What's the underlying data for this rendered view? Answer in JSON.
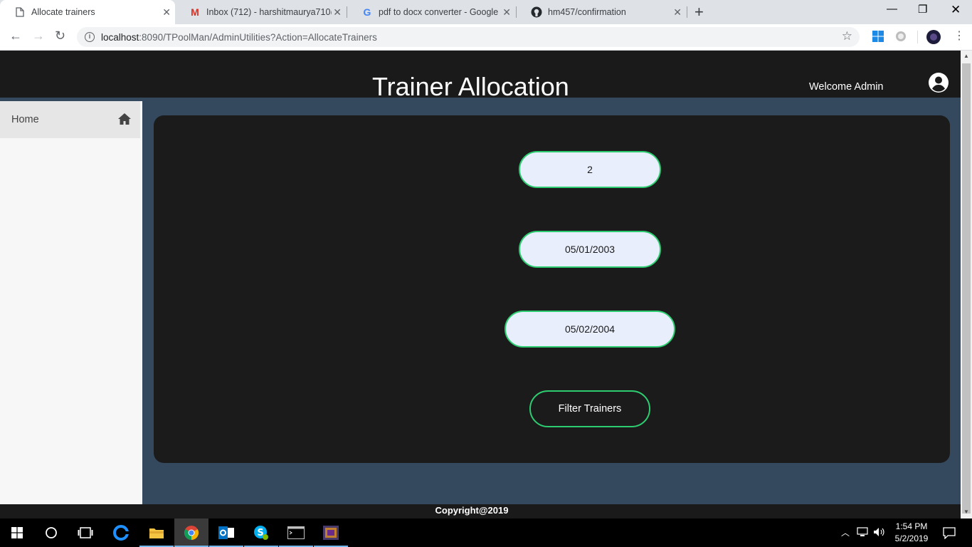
{
  "browser": {
    "tabs": [
      {
        "title": "Allocate trainers",
        "icon": "document-icon"
      },
      {
        "title": "Inbox (712) - harshitmaurya710@",
        "icon": "gmail-icon"
      },
      {
        "title": "pdf to docx converter - Google S",
        "icon": "google-icon"
      },
      {
        "title": "hm457/confirmation",
        "icon": "github-icon"
      }
    ],
    "url_host": "localhost",
    "url_rest": ":8090/TPoolMan/AdminUtilities?Action=AllocateTrainers"
  },
  "header": {
    "title": "Trainer Allocation",
    "welcome": "Welcome Admin",
    "user_icon": "user-circle-icon"
  },
  "sidebar": {
    "items": [
      {
        "label": "Home",
        "icon": "home-icon"
      }
    ]
  },
  "form": {
    "field1_value": "2",
    "field2_value": "05/01/2003",
    "field3_value": "05/02/2004",
    "submit_label": "Filter Trainers"
  },
  "footer": {
    "copyright": "Copyright@2019"
  },
  "taskbar": {
    "time": "1:54 PM",
    "date": "5/2/2019"
  },
  "colors": {
    "header_bg": "#1a1a1a",
    "page_bg": "#34495e",
    "card_bg": "#1b1b1b",
    "accent": "#2ecc71",
    "field_bg": "#e8eefc"
  }
}
